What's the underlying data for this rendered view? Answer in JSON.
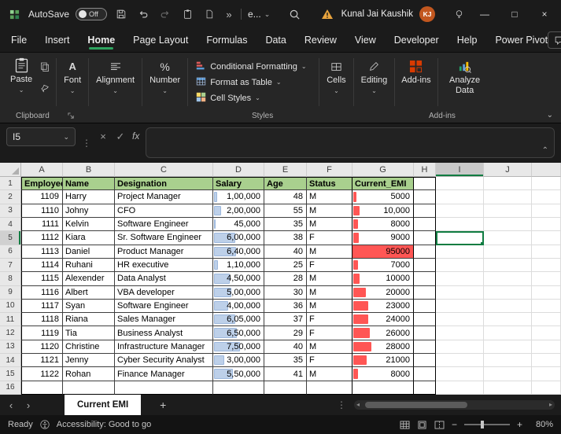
{
  "titlebar": {
    "autosave_label": "AutoSave",
    "autosave_state": "Off",
    "document_menu": "e...",
    "user_name": "Kunal Jai Kaushik",
    "user_initials": "KJ"
  },
  "menubar": {
    "items": [
      "File",
      "Insert",
      "Home",
      "Page Layout",
      "Formulas",
      "Data",
      "Review",
      "View",
      "Developer",
      "Help",
      "Power Pivot"
    ],
    "active_item": "Home"
  },
  "ribbon": {
    "paste_label": "Paste",
    "font_label": "Font",
    "alignment_label": "Alignment",
    "number_label": "Number",
    "conditional_formatting_label": "Conditional Formatting",
    "format_as_table_label": "Format as Table",
    "cell_styles_label": "Cell Styles",
    "cells_label": "Cells",
    "editing_label": "Editing",
    "addins_button_label": "Add-ins",
    "analyze_data_label": "Analyze Data",
    "clipboard_group_label": "Clipboard",
    "styles_group_label": "Styles",
    "addins_group_label": "Add-ins"
  },
  "formula_bar": {
    "name_box_value": "I5",
    "fx_label": "fx",
    "formula_value": ""
  },
  "grid": {
    "column_letters": [
      "A",
      "B",
      "C",
      "D",
      "E",
      "F",
      "G",
      "H",
      "I",
      "J"
    ],
    "selected_cell": "I5",
    "selected_column": "I",
    "selected_row": 5,
    "table_headers": [
      "Employee",
      "Name",
      "Designation",
      "Salary",
      "Age",
      "Status",
      "Current_EMI"
    ],
    "salary_bar_max": 750000,
    "emi_bar_max": 95000,
    "colors": {
      "table_header_bg": "#a9d08e",
      "salary_bar": "#bdd0e9",
      "emi_bar": "#ff5654",
      "selection": "#107c41"
    },
    "rows": [
      {
        "employee": "1109",
        "name": "Harry",
        "designation": "Project Manager",
        "salary": "1,00,000",
        "salary_value": 100000,
        "age": "48",
        "status": "M",
        "emi": "5000",
        "emi_value": 5000
      },
      {
        "employee": "1110",
        "name": "Johny",
        "designation": "CFO",
        "salary": "2,00,000",
        "salary_value": 200000,
        "age": "55",
        "status": "M",
        "emi": "10,000",
        "emi_value": 10000
      },
      {
        "employee": "1111",
        "name": "Kelvin",
        "designation": "Software Engineer",
        "salary": "45,000",
        "salary_value": 45000,
        "age": "35",
        "status": "M",
        "emi": "8000",
        "emi_value": 8000
      },
      {
        "employee": "1112",
        "name": "Kiara",
        "designation": "Sr. Software Engineer",
        "salary": "6,00,000",
        "salary_value": 600000,
        "age": "38",
        "status": "F",
        "emi": "9000",
        "emi_value": 9000
      },
      {
        "employee": "1113",
        "name": "Daniel",
        "designation": "Product Manager",
        "salary": "6,40,000",
        "salary_value": 640000,
        "age": "40",
        "status": "M",
        "emi": "95000",
        "emi_value": 95000
      },
      {
        "employee": "1114",
        "name": "Ruhani",
        "designation": "HR executive",
        "salary": "1,10,000",
        "salary_value": 110000,
        "age": "25",
        "status": "F",
        "emi": "7000",
        "emi_value": 7000
      },
      {
        "employee": "1115",
        "name": "Alexender",
        "designation": "Data Analyst",
        "salary": "4,50,000",
        "salary_value": 450000,
        "age": "28",
        "status": "M",
        "emi": "10000",
        "emi_value": 10000
      },
      {
        "employee": "1116",
        "name": "Albert",
        "designation": "VBA developer",
        "salary": "5,00,000",
        "salary_value": 500000,
        "age": "30",
        "status": "M",
        "emi": "20000",
        "emi_value": 20000
      },
      {
        "employee": "1117",
        "name": "Syan",
        "designation": "Software Engineer",
        "salary": "4,00,000",
        "salary_value": 400000,
        "age": "36",
        "status": "M",
        "emi": "23000",
        "emi_value": 23000
      },
      {
        "employee": "1118",
        "name": "Riana",
        "designation": "Sales Manager",
        "salary": "6,05,000",
        "salary_value": 605000,
        "age": "37",
        "status": "F",
        "emi": "24000",
        "emi_value": 24000
      },
      {
        "employee": "1119",
        "name": "Tia",
        "designation": "Business Analyst",
        "salary": "6,50,000",
        "salary_value": 650000,
        "age": "29",
        "status": "F",
        "emi": "26000",
        "emi_value": 26000
      },
      {
        "employee": "1120",
        "name": "Christine",
        "designation": "Infrastructure Manager",
        "salary": "7,50,000",
        "salary_value": 750000,
        "age": "40",
        "status": "M",
        "emi": "28000",
        "emi_value": 28000
      },
      {
        "employee": "1121",
        "name": "Jenny",
        "designation": "Cyber Security Analyst",
        "salary": "3,00,000",
        "salary_value": 300000,
        "age": "35",
        "status": "F",
        "emi": "21000",
        "emi_value": 21000
      },
      {
        "employee": "1122",
        "name": "Rohan",
        "designation": "Finance Manager",
        "salary": "5,50,000",
        "salary_value": 550000,
        "age": "41",
        "status": "M",
        "emi": "8000",
        "emi_value": 8000
      }
    ]
  },
  "sheet_tabs": {
    "tabs": [
      {
        "label": "Current EMI",
        "active": true
      }
    ]
  },
  "status_bar": {
    "ready_label": "Ready",
    "accessibility_text": "Accessibility: Good to go",
    "zoom_level": "80%"
  }
}
